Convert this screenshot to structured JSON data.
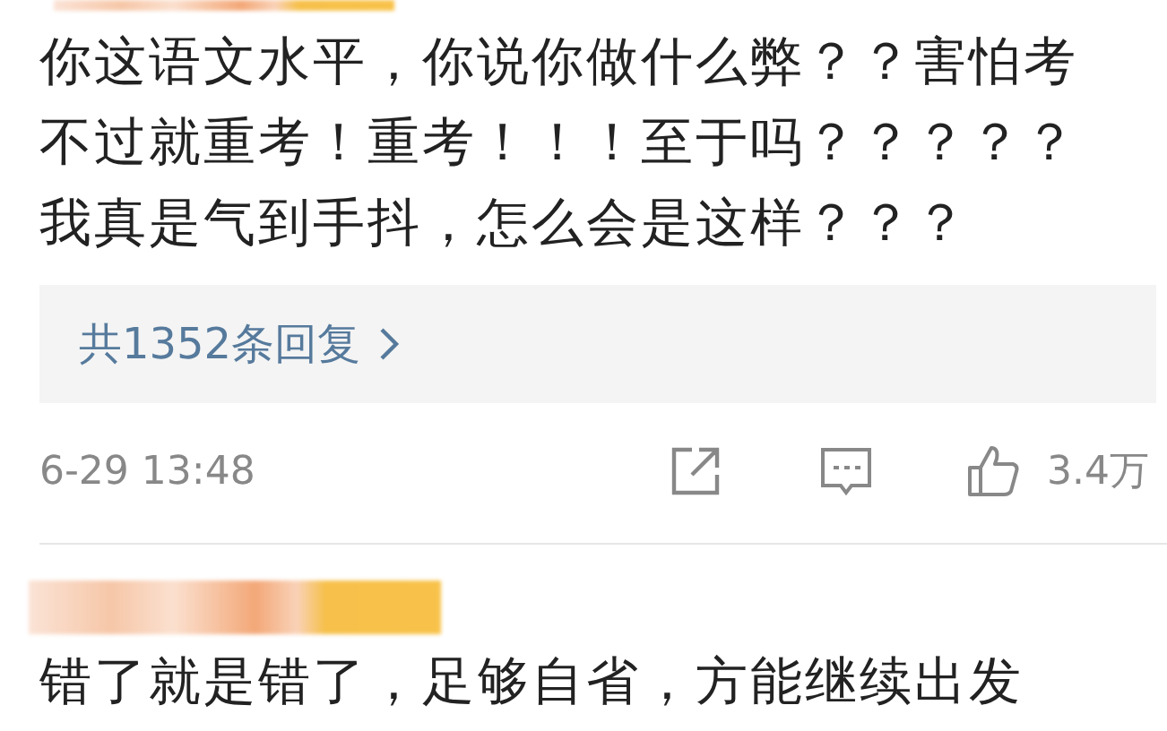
{
  "comments": [
    {
      "text": "你这语文水平，你说你做什么弊？？害怕考不过就重考！重考！！！至于吗？？？？？我真是气到手抖，怎么会是这样？？？",
      "replies": "共1352条回复",
      "time": "6-29 13:48",
      "likes": "3.4万"
    },
    {
      "text": "错了就是错了，足够自省，方能继续出发"
    }
  ]
}
